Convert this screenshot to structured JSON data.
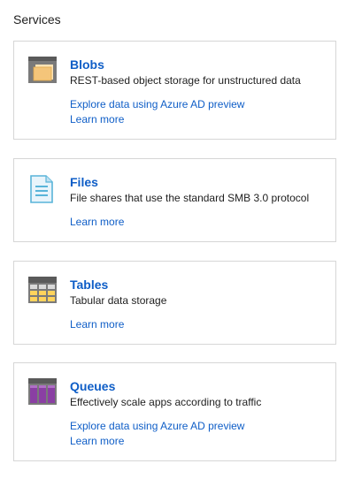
{
  "heading": "Services",
  "services": [
    {
      "icon": "blob-storage-icon",
      "title": "Blobs",
      "description": "REST-based object storage for unstructured data",
      "explore_link": "Explore data using Azure AD preview",
      "learn_more": "Learn more"
    },
    {
      "icon": "file-share-icon",
      "title": "Files",
      "description": "File shares that use the standard SMB 3.0 protocol",
      "explore_link": "",
      "learn_more": "Learn more"
    },
    {
      "icon": "table-storage-icon",
      "title": "Tables",
      "description": "Tabular data storage",
      "explore_link": "",
      "learn_more": "Learn more"
    },
    {
      "icon": "queue-storage-icon",
      "title": "Queues",
      "description": "Effectively scale apps according to traffic",
      "explore_link": "Explore data using Azure AD preview",
      "learn_more": "Learn more"
    }
  ],
  "colors": {
    "link": "#0f5ec7",
    "border": "#d6d6d6",
    "blob_folder": "#f4c57a",
    "file_blue": "#59b4d9",
    "table_yellow": "#ffd35c",
    "queue_purple": "#8a3fa3"
  }
}
